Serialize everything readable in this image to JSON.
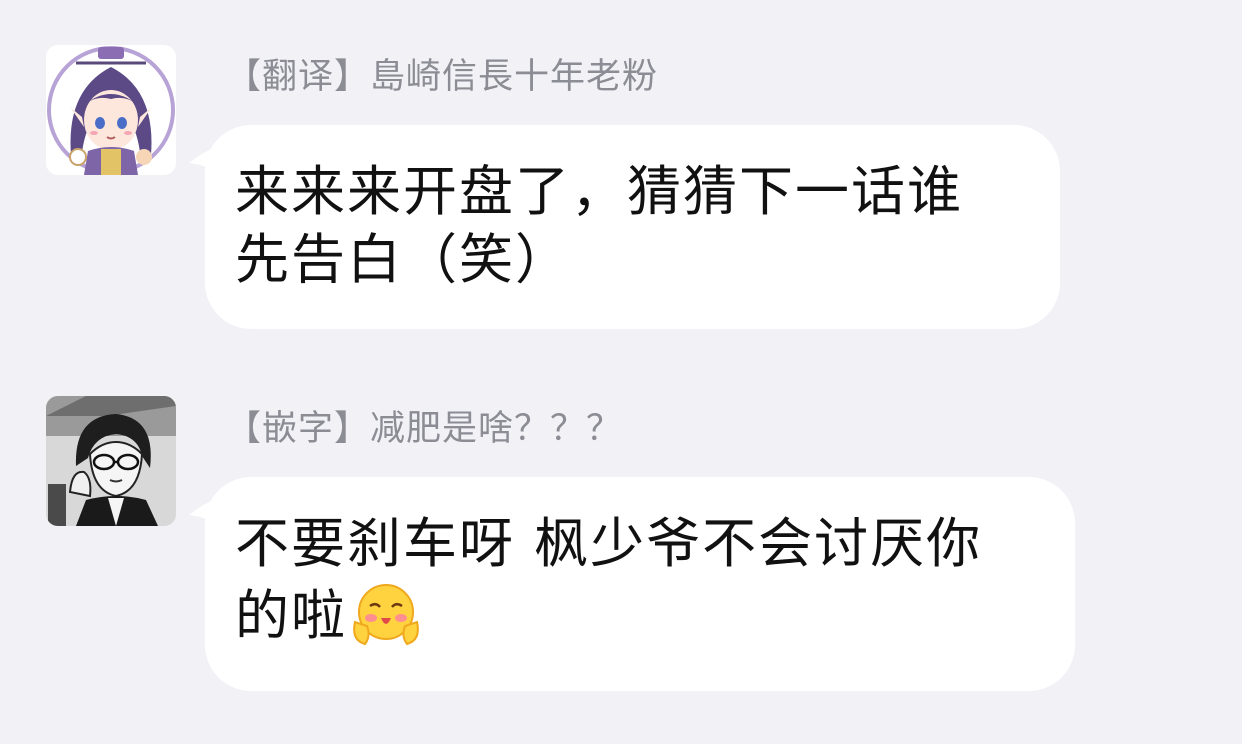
{
  "messages": [
    {
      "sender": "【翻译】島崎信長十年老粉",
      "lines": [
        "来来来开盘了，猜猜下一话谁",
        "先告白（笑）"
      ],
      "avatar": "anime-avatar-purple-hair"
    },
    {
      "sender": "【嵌字】减肥是啥？？？",
      "lines": [
        "不要刹车呀 枫少爷不会讨厌你",
        "的啦"
      ],
      "emoji": "blushing-emoji",
      "avatar": "manga-avatar-glasses"
    }
  ],
  "colors": {
    "background": "#f1f1f6",
    "bubble": "#ffffff",
    "sender_text": "#8c8c95",
    "message_text": "#111111"
  }
}
